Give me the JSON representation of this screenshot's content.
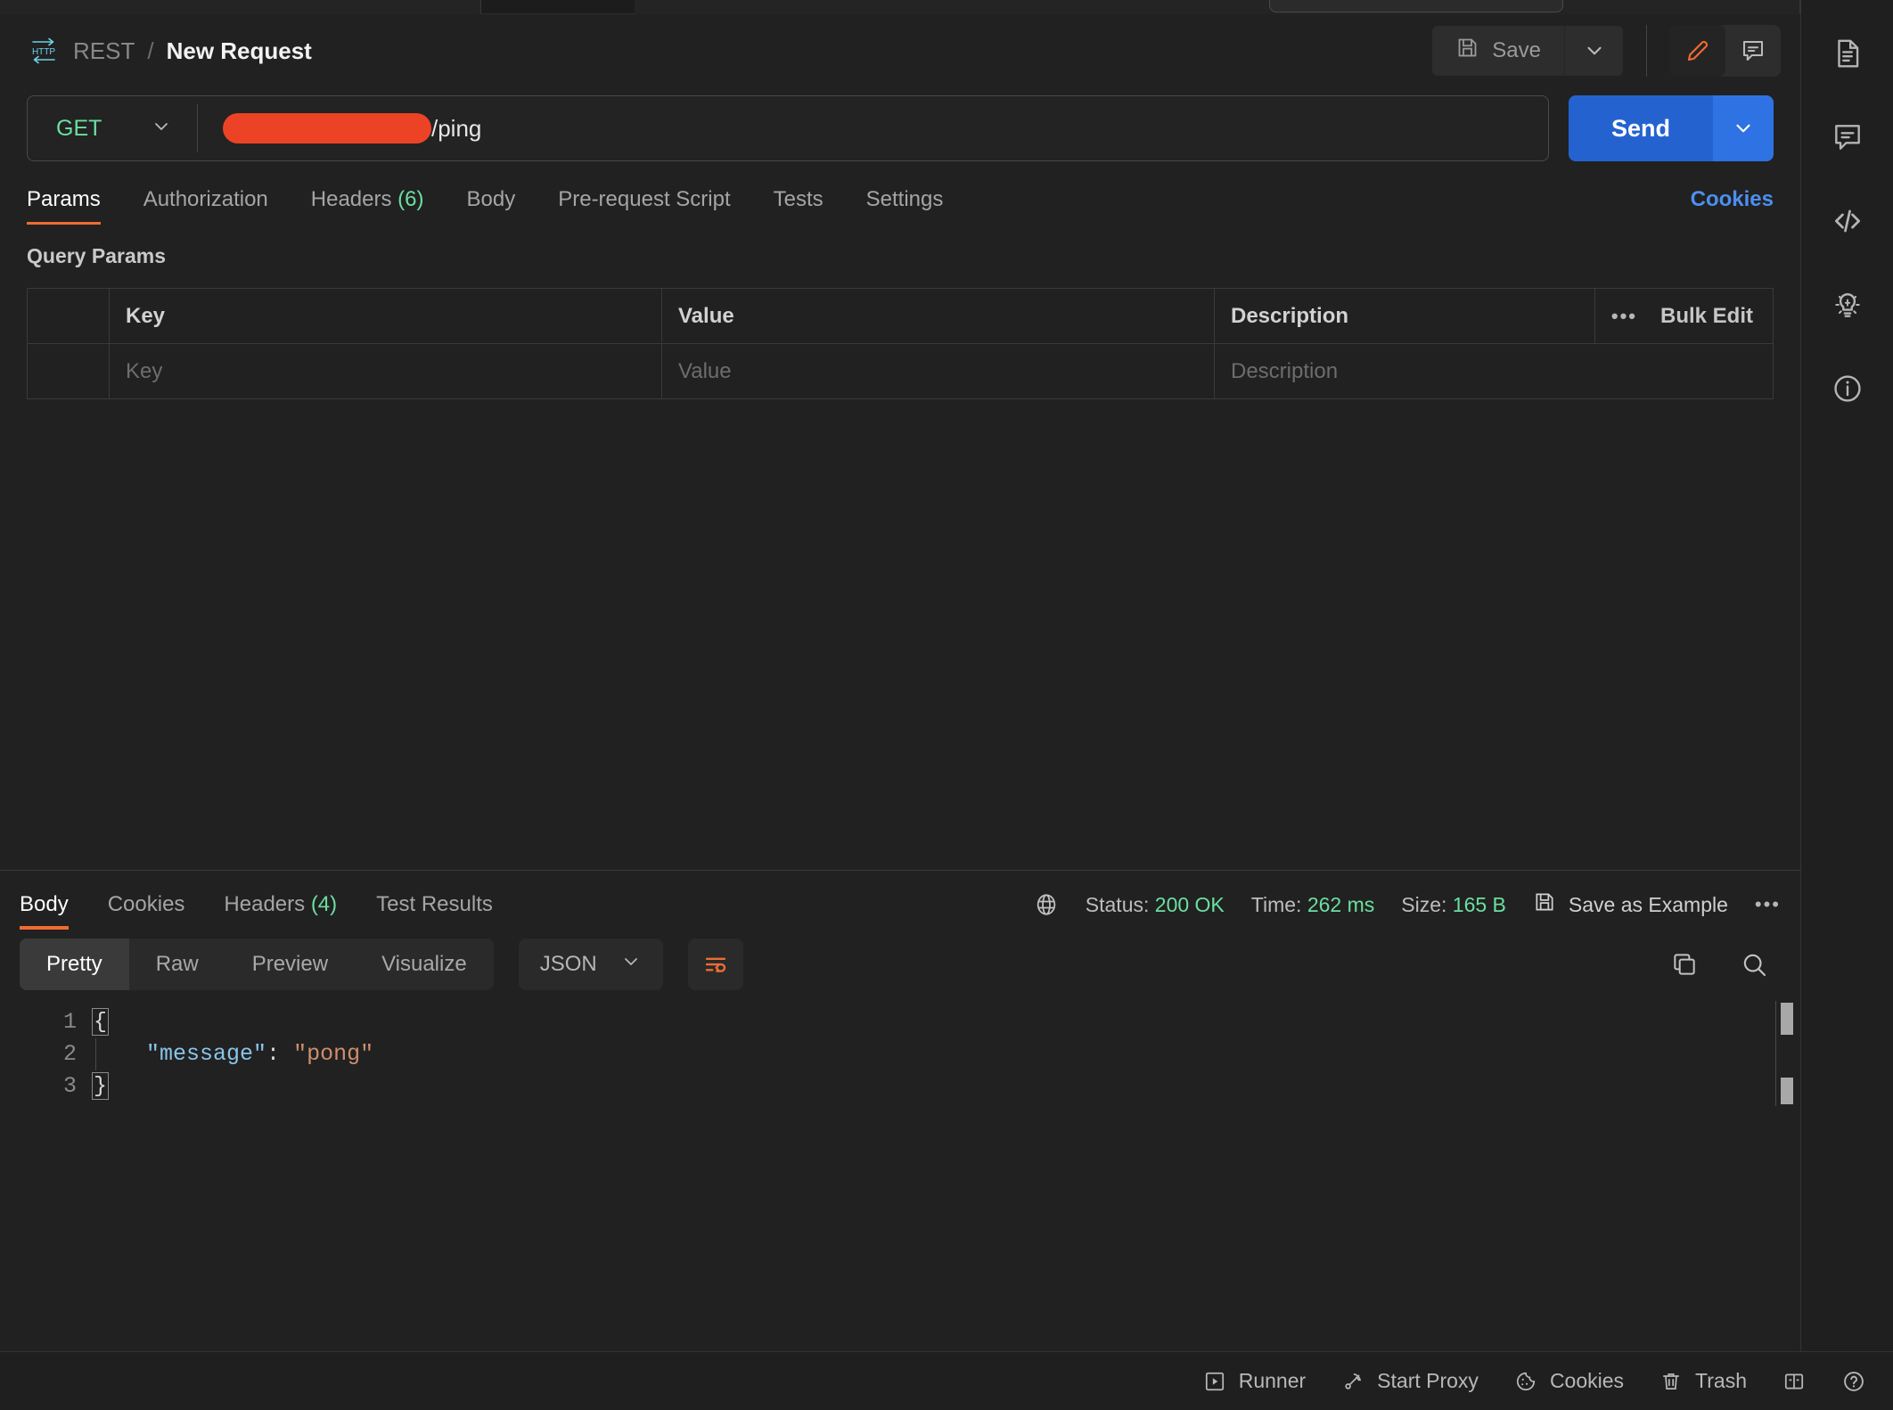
{
  "header": {
    "protocol_icon": "http-icon",
    "breadcrumb_root": "REST",
    "breadcrumb_separator": "/",
    "breadcrumb_title": "New Request",
    "save_label": "Save",
    "save_caret_icon": "chevron-down-icon",
    "edit_icon": "pencil-icon",
    "comment_icon": "comment-icon"
  },
  "url_bar": {
    "method": "GET",
    "method_caret_icon": "chevron-down-icon",
    "url_redacted": true,
    "url_visible_text": "/ping",
    "send_label": "Send",
    "send_caret_icon": "chevron-down-icon"
  },
  "request_tabs": {
    "items": [
      {
        "label": "Params",
        "count": "",
        "active": true
      },
      {
        "label": "Authorization",
        "count": "",
        "active": false
      },
      {
        "label": "Headers",
        "count": "(6)",
        "active": false
      },
      {
        "label": "Body",
        "count": "",
        "active": false
      },
      {
        "label": "Pre-request Script",
        "count": "",
        "active": false
      },
      {
        "label": "Tests",
        "count": "",
        "active": false
      },
      {
        "label": "Settings",
        "count": "",
        "active": false
      }
    ],
    "cookies_link": "Cookies"
  },
  "query_params": {
    "section_title": "Query Params",
    "columns": [
      "Key",
      "Value",
      "Description"
    ],
    "bulk_edit_label": "Bulk Edit",
    "bulk_dots_icon": "more-horizontal-icon",
    "rows": [
      {
        "key": "",
        "value": "",
        "description": ""
      }
    ],
    "placeholders": {
      "key": "Key",
      "value": "Value",
      "description": "Description"
    }
  },
  "response": {
    "tabs": [
      {
        "label": "Body",
        "count": "",
        "active": true
      },
      {
        "label": "Cookies",
        "count": "",
        "active": false
      },
      {
        "label": "Headers",
        "count": "(4)",
        "active": false
      },
      {
        "label": "Test Results",
        "count": "",
        "active": false
      }
    ],
    "globe_icon": "globe-icon",
    "status_label": "Status:",
    "status_value": "200 OK",
    "time_label": "Time:",
    "time_value": "262 ms",
    "size_label": "Size:",
    "size_value": "165 B",
    "save_example_label": "Save as Example",
    "save_example_icon": "save-icon",
    "more_icon": "more-horizontal-icon",
    "view_modes": [
      {
        "label": "Pretty",
        "active": true
      },
      {
        "label": "Raw",
        "active": false
      },
      {
        "label": "Preview",
        "active": false
      },
      {
        "label": "Visualize",
        "active": false
      }
    ],
    "format": "JSON",
    "format_caret_icon": "chevron-down-icon",
    "wrap_icon": "word-wrap-icon",
    "copy_icon": "copy-icon",
    "search_icon": "search-icon",
    "body_lines": [
      {
        "number": "1",
        "text": "{"
      },
      {
        "number": "2",
        "key": "\"message\"",
        "colon": ":",
        "value": "\"pong\""
      },
      {
        "number": "3",
        "text": "}"
      }
    ]
  },
  "right_rail": {
    "items": [
      {
        "name": "documentation-icon"
      },
      {
        "name": "comments-icon"
      },
      {
        "name": "code-snippet-icon"
      },
      {
        "name": "insights-icon"
      },
      {
        "name": "info-icon"
      }
    ]
  },
  "footer": {
    "items": [
      {
        "label": "Runner",
        "icon": "runner-icon"
      },
      {
        "label": "Start Proxy",
        "icon": "proxy-icon"
      },
      {
        "label": "Cookies",
        "icon": "cookie-icon"
      },
      {
        "label": "Trash",
        "icon": "trash-icon"
      }
    ],
    "layout_icon": "two-pane-layout-icon",
    "help_icon": "help-circle-icon"
  },
  "colors": {
    "background": "#212121",
    "accent_orange": "#ef6c33",
    "accent_blue": "#2463cf",
    "status_green": "#6bdfa0",
    "redaction": "#ec4326",
    "link_blue": "#4c8ff0"
  }
}
